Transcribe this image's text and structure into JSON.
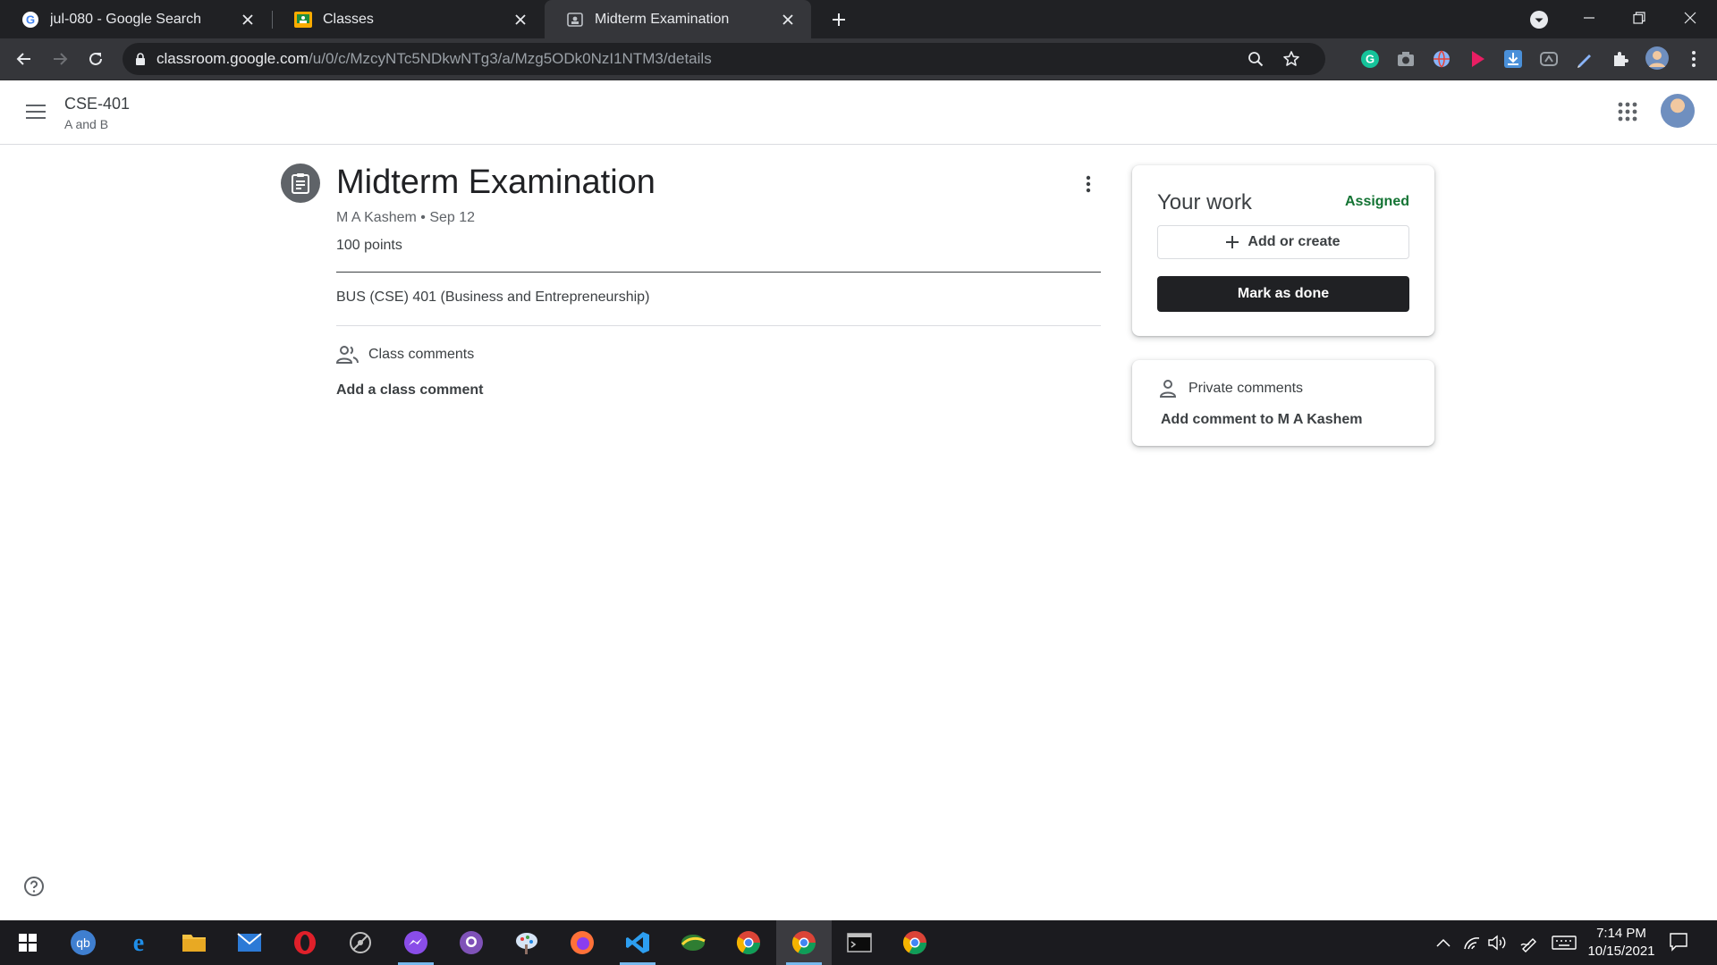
{
  "browser": {
    "tabs": [
      {
        "title": "jul-080 - Google Search",
        "active": false
      },
      {
        "title": "Classes",
        "active": false
      },
      {
        "title": "Midterm Examination",
        "active": true
      }
    ],
    "url_host": "classroom.google.com",
    "url_path": "/u/0/c/MzcyNTc5NDkwNTg3/a/Mzg5ODk0NzI1NTM3/details"
  },
  "header": {
    "class_name": "CSE-401",
    "class_section": "A and B"
  },
  "assignment": {
    "title": "Midterm Examination",
    "meta": "M A Kashem • Sep 12",
    "points": "100 points",
    "description": "BUS (CSE) 401 (Business and Entrepreneurship)",
    "class_comments_label": "Class comments",
    "add_class_comment": "Add a class comment"
  },
  "your_work": {
    "title": "Your work",
    "status": "Assigned",
    "add_or_create": "Add or create",
    "mark_as_done": "Mark as done"
  },
  "private_comments": {
    "label": "Private comments",
    "add": "Add comment to M A Kashem"
  },
  "taskbar": {
    "time": "7:14 PM",
    "date": "10/15/2021"
  },
  "colors": {
    "assigned_green": "#137333",
    "primary_button": "#202124",
    "chrome_dark": "#202124"
  }
}
